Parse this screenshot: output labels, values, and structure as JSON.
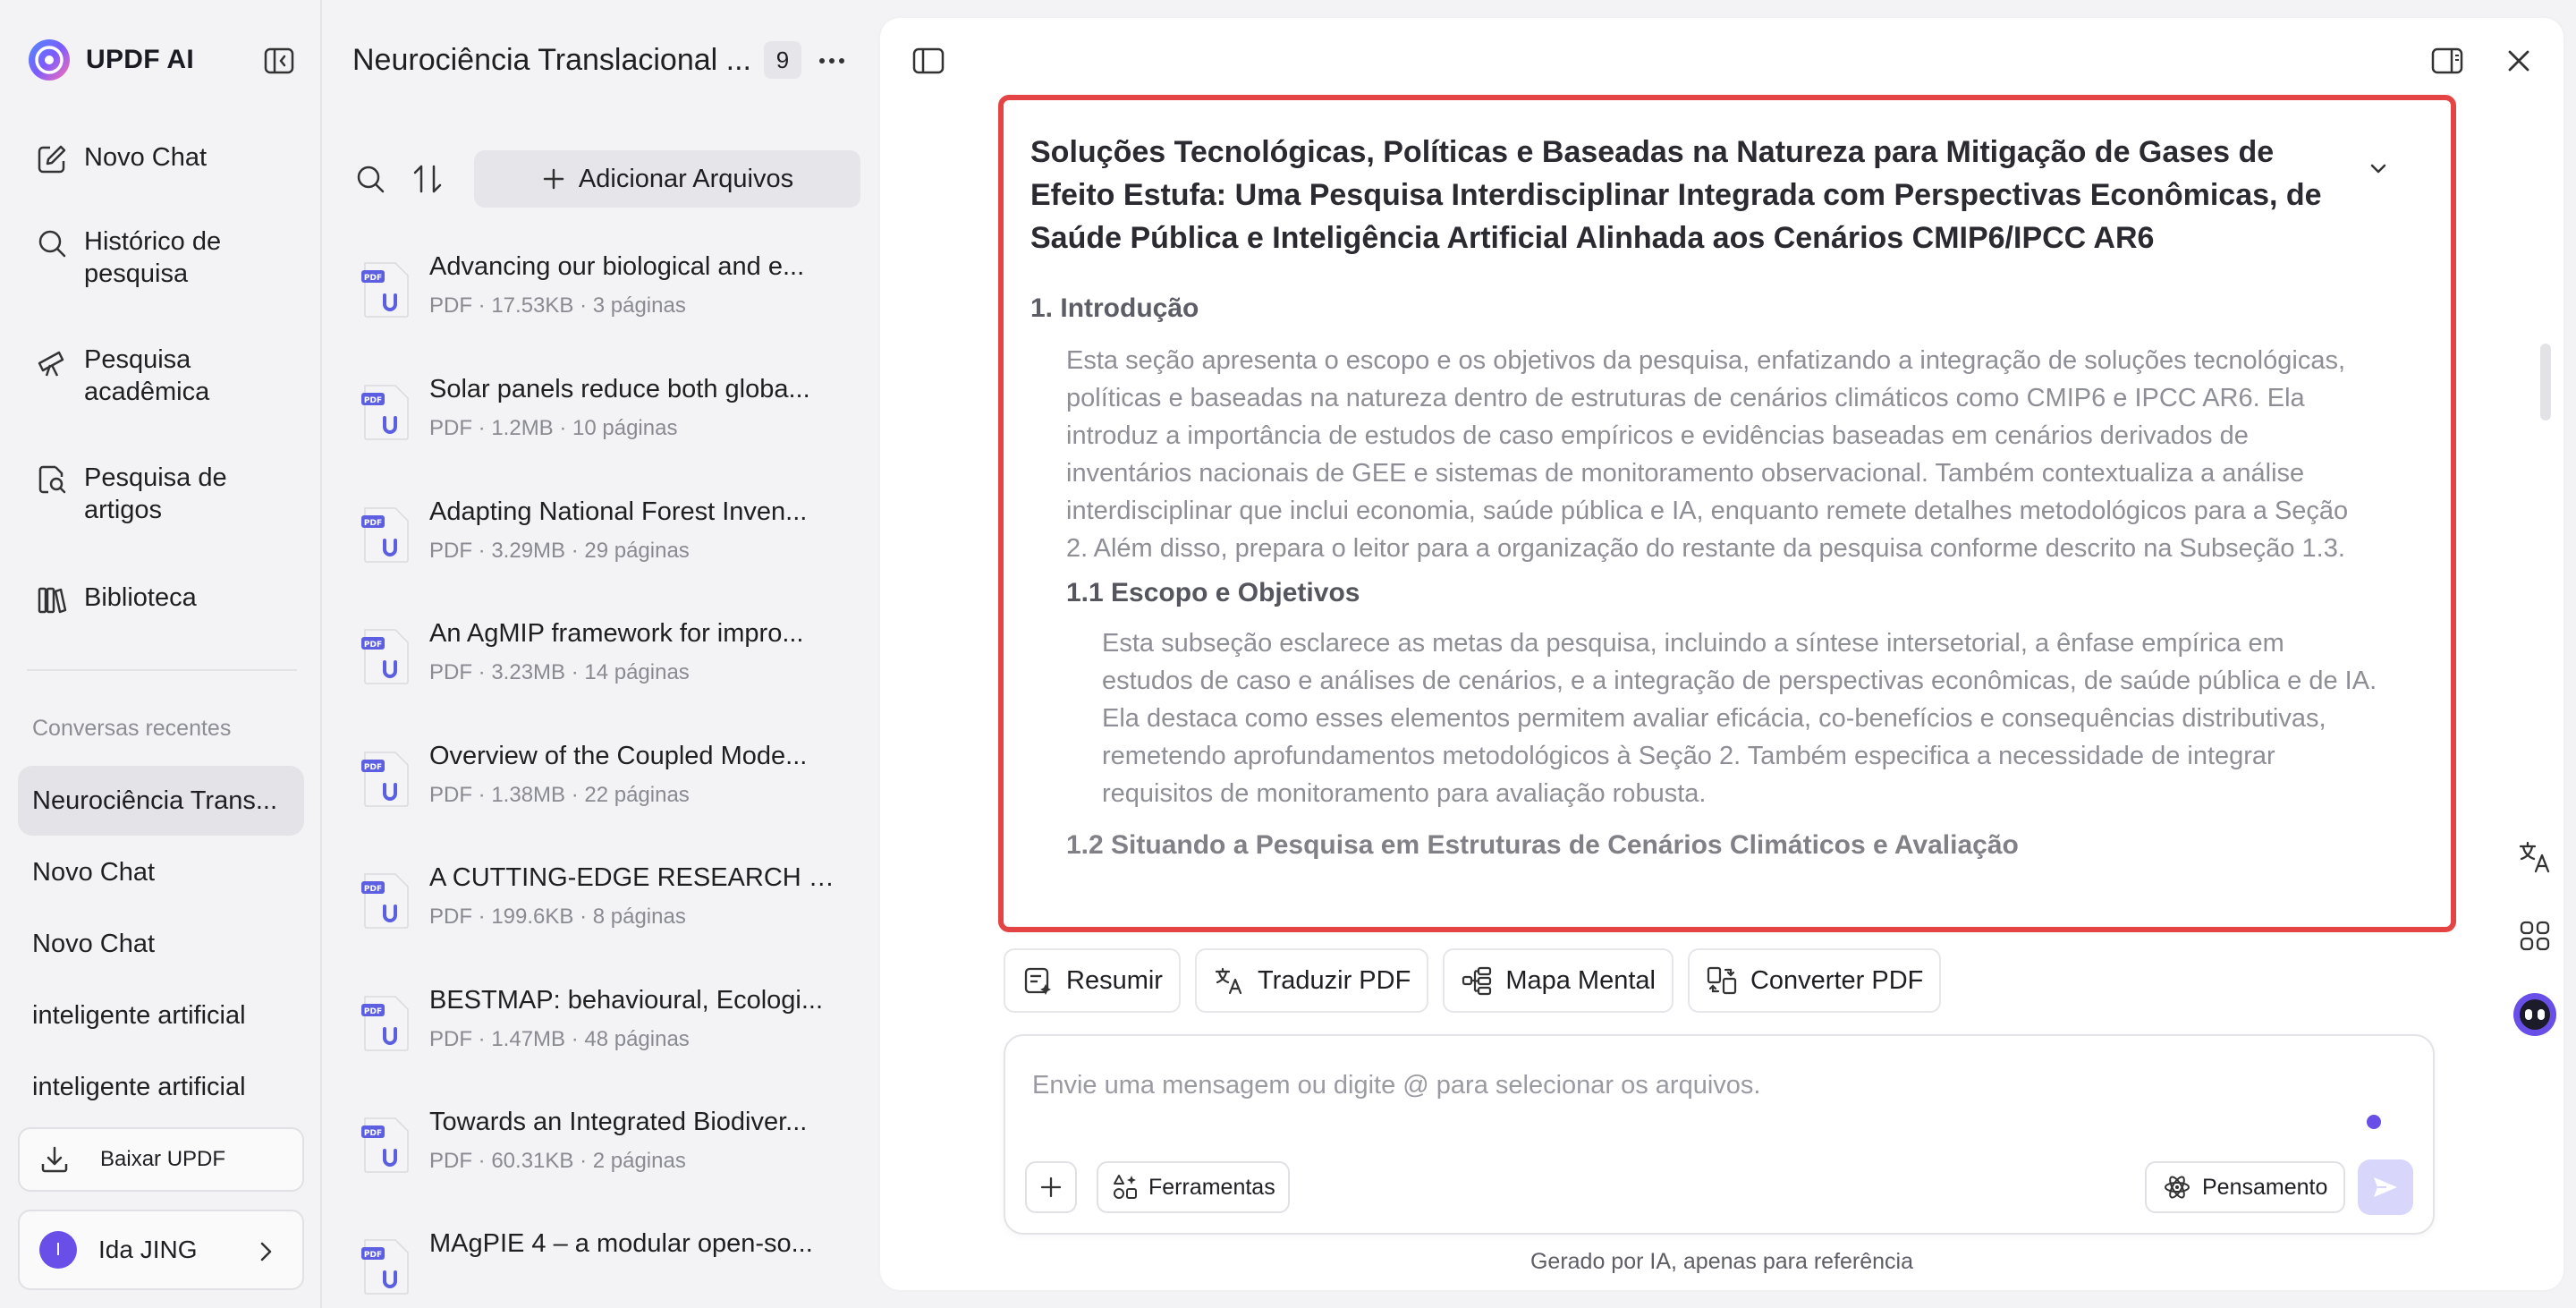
{
  "app": {
    "brand_name": "UPDF AI",
    "accent": "#6a4ee8",
    "highlight_border": "#e54444"
  },
  "sidebar": {
    "nav": [
      {
        "label": "Novo Chat",
        "icon": "edit-chat-icon"
      },
      {
        "label": "Histórico de pesquisa",
        "icon": "search-icon"
      },
      {
        "label": "Pesquisa acadêmica",
        "icon": "telescope-icon"
      },
      {
        "label": "Pesquisa de artigos",
        "icon": "document-search-icon"
      },
      {
        "label": "Biblioteca",
        "icon": "library-icon"
      }
    ],
    "recent_title": "Conversas recentes",
    "recent": [
      "Neurociência Trans...",
      "Novo Chat",
      "Novo Chat",
      "inteligente artificial",
      "inteligente artificial"
    ],
    "download_label": "Baixar UPDF",
    "user": {
      "initial": "I",
      "name": "Ida JING"
    }
  },
  "files": {
    "title": "Neurociência Translacional ...",
    "count": "9",
    "add_label": "Adicionar Arquivos",
    "items": [
      {
        "title": "Advancing our biological and e...",
        "meta": "PDF · 17.53KB · 3 páginas"
      },
      {
        "title": "Solar panels reduce both globa...",
        "meta": "PDF · 1.2MB · 10 páginas"
      },
      {
        "title": "Adapting National Forest Inven...",
        "meta": "PDF · 3.29MB · 29 páginas"
      },
      {
        "title": "An AgMIP framework for impro...",
        "meta": "PDF · 3.23MB · 14 páginas"
      },
      {
        "title": "Overview of the Coupled Mode...",
        "meta": "PDF · 1.38MB · 22 páginas"
      },
      {
        "title": "A CUTTING-EDGE RESEARCH O...",
        "meta": "PDF · 199.6KB · 8 páginas"
      },
      {
        "title": "BESTMAP: behavioural, Ecologi...",
        "meta": "PDF · 1.47MB · 48 páginas"
      },
      {
        "title": "Towards an Integrated Biodiver...",
        "meta": "PDF · 60.31KB · 2 páginas"
      },
      {
        "title": "MAgPIE 4 – a modular open-so...",
        "meta": ""
      }
    ]
  },
  "document": {
    "title": "Soluções Tecnológicas, Políticas e Baseadas na Natureza para Mitigação de Gases de Efeito Estufa: Uma Pesquisa Interdisciplinar Integrada com Perspectivas Econômicas, de Saúde Pública e Inteligência Artificial Alinhada aos Cenários CMIP6/IPCC AR6",
    "section1": "1. Introdução",
    "section1_text": "Esta seção apresenta o escopo e os objetivos da pesquisa, enfatizando a integração de soluções tecnológicas, políticas e baseadas na natureza dentro de estruturas de cenários climáticos como CMIP6 e IPCC AR6. Ela introduz a importância de estudos de caso empíricos e evidências baseadas em cenários derivados de inventários nacionais de GEE e sistemas de monitoramento observacional. Também contextualiza a análise interdisciplinar que inclui economia, saúde pública e IA, enquanto remete detalhes metodológicos para a Seção 2. Além disso, prepara o leitor para a organização do restante da pesquisa conforme descrito na Subseção 1.3.",
    "section1_1": "1.1 Escopo e Objetivos",
    "section1_1_text": "Esta subseção esclarece as metas da pesquisa, incluindo a síntese intersetorial, a ênfase empírica em estudos de caso e análises de cenários, e a integração de perspectivas econômicas, de saúde pública e de IA. Ela destaca como esses elementos permitem avaliar eficácia, co-benefícios e consequências distributivas, remetendo aprofundamentos metodológicos à Seção 2. Também especifica a necessidade de integrar requisitos de monitoramento para avaliação robusta.",
    "section1_2": "1.2 Situando a Pesquisa em Estruturas de Cenários Climáticos e Avaliação"
  },
  "quick_actions": [
    {
      "label": "Resumir",
      "icon": "summary-icon"
    },
    {
      "label": "Traduzir PDF",
      "icon": "translate-icon"
    },
    {
      "label": "Mapa Mental",
      "icon": "mindmap-icon"
    },
    {
      "label": "Converter PDF",
      "icon": "convert-icon"
    }
  ],
  "composer": {
    "placeholder": "Envie uma mensagem ou digite @ para selecionar os arquivos.",
    "tools_label": "Ferramentas",
    "thinking_label": "Pensamento"
  },
  "disclaimer": "Gerado por IA, apenas para referência"
}
